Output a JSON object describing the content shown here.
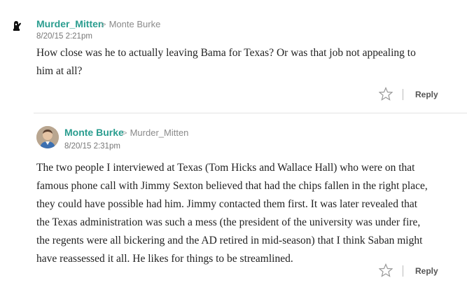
{
  "comments": [
    {
      "author": "Murder_Mitten",
      "reply_to": "Monte Burke",
      "timestamp": "8/20/15 2:21pm",
      "lines": [
        "How close was he to actually leaving Bama for Texas? Or was that job not appealing to",
        "him at all?"
      ],
      "reply_label": "Reply",
      "avatar_icon": "mitten-icon"
    },
    {
      "author": "Monte Burke",
      "reply_to": "Murder_Mitten",
      "timestamp": "8/20/15 2:31pm",
      "lines": [
        "The two people I interviewed at Texas (Tom Hicks and Wallace Hall) who were on that",
        "famous phone call with Jimmy Sexton believed that had the chips fallen in the right place,",
        "they could have possible had him. Jimmy contacted them first. It was later revealed that",
        "the Texas administration was such a mess (the president of the university was under fire,",
        "the regents were all bickering and the AD retired in mid-season) that I think Saban might",
        "have reassessed it all. He likes for things to be streamlined."
      ],
      "reply_label": "Reply",
      "avatar_icon": "profile-photo"
    }
  ],
  "colors": {
    "author": "#2a9d8f",
    "meta": "#8a8a8a",
    "divider": "#e3e3e3"
  }
}
